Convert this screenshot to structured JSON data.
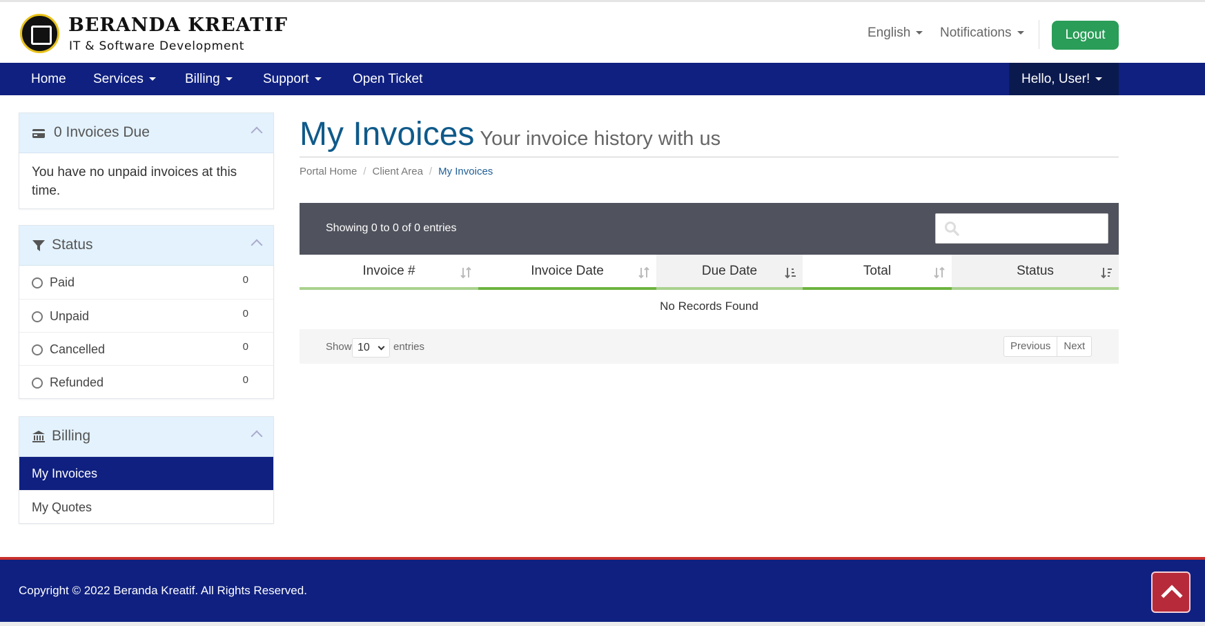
{
  "brand": {
    "title": "BERANDA KREATIF",
    "subtitle": "IT & Software Development"
  },
  "topbar": {
    "language": "English",
    "notifications": "Notifications",
    "logout": "Logout"
  },
  "nav": {
    "items": [
      "Home",
      "Services",
      "Billing",
      "Support",
      "Open Ticket"
    ],
    "user": "Hello, User!"
  },
  "sidebar": {
    "invoices_due": {
      "title": "0 Invoices Due",
      "body": "You have no unpaid invoices at this time."
    },
    "status": {
      "title": "Status",
      "items": [
        {
          "label": "Paid",
          "count": "0"
        },
        {
          "label": "Unpaid",
          "count": "0"
        },
        {
          "label": "Cancelled",
          "count": "0"
        },
        {
          "label": "Refunded",
          "count": "0"
        }
      ]
    },
    "billing": {
      "title": "Billing",
      "items": [
        "My Invoices",
        "My Quotes"
      ]
    }
  },
  "page": {
    "title": "My Invoices",
    "subtitle": "Your invoice history with us",
    "breadcrumb": [
      "Portal Home",
      "Client Area",
      "My Invoices"
    ]
  },
  "table": {
    "info": "Showing 0 to 0 of 0 entries",
    "columns": [
      "Invoice #",
      "Invoice Date",
      "Due Date",
      "Total",
      "Status"
    ],
    "empty": "No Records Found",
    "show_label": "Show",
    "page_length": "10",
    "entries_label": "entries",
    "previous": "Previous",
    "next": "Next"
  },
  "footer": {
    "copyright": "Copyright © 2022 Beranda Kreatif. All Rights Reserved."
  },
  "colors": {
    "nav_bg": "#0f2080",
    "accent_green": "#2a9d58",
    "column_bar_light": "#a9d18e",
    "column_bar_dark": "#6db33f",
    "footer_accent": "#c9302c"
  }
}
